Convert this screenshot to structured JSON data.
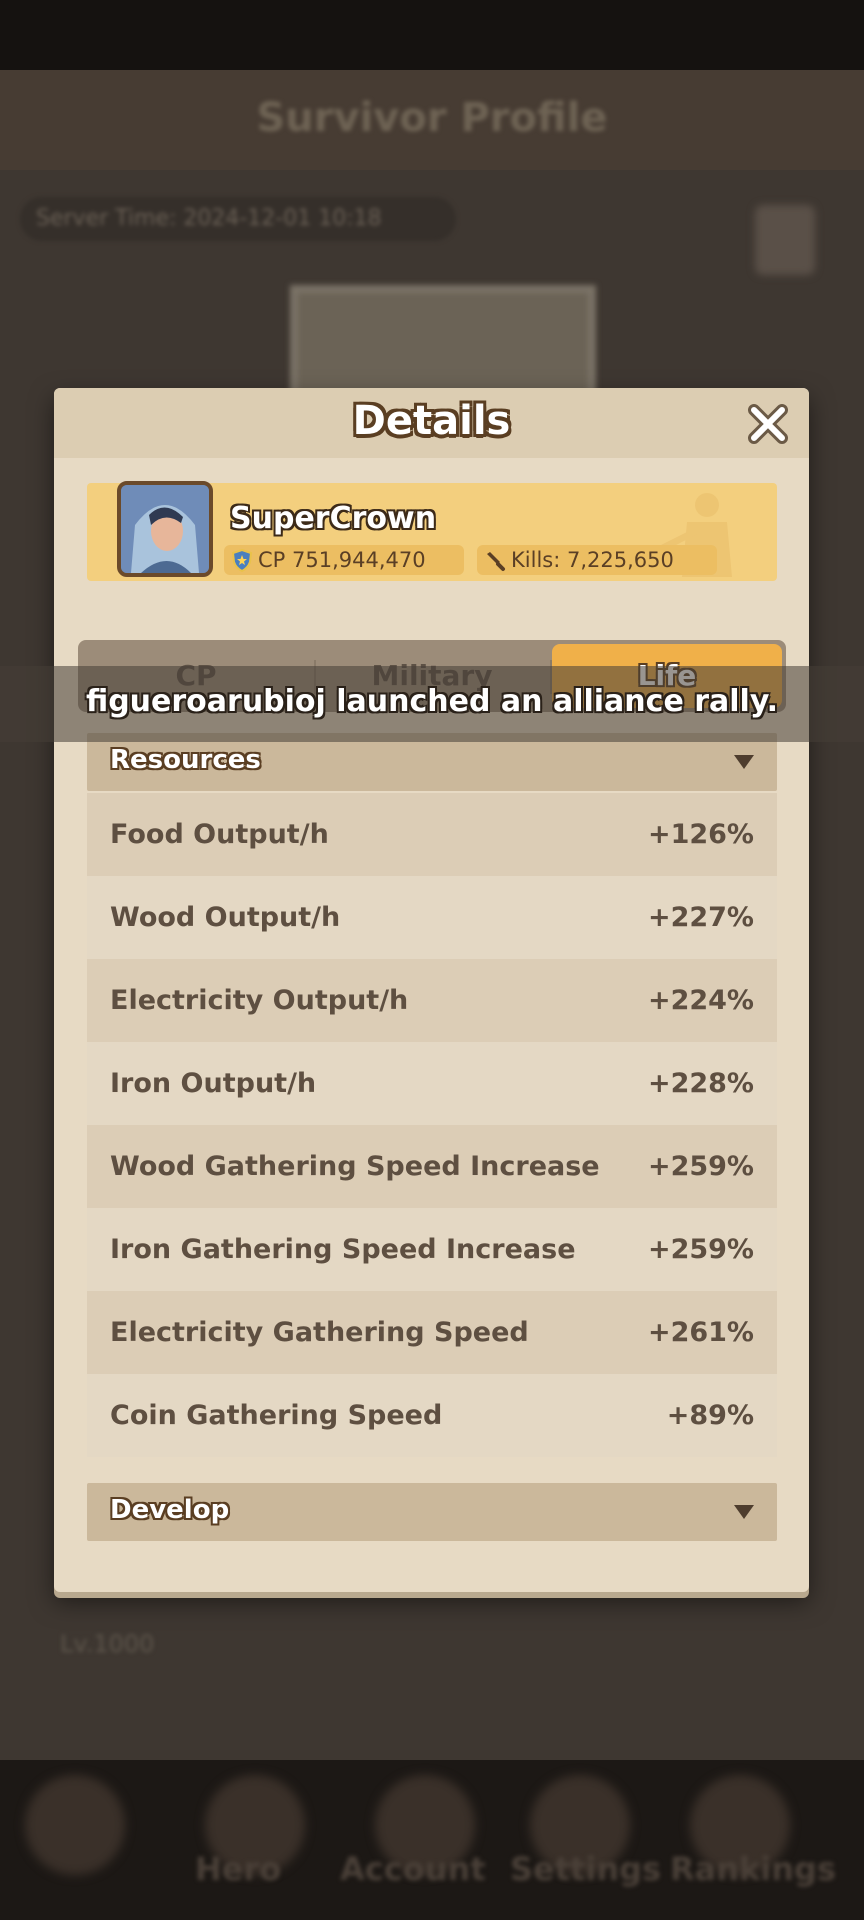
{
  "background": {
    "page_title": "Survivor Profile",
    "server_time": "Server Time: 2024-12-01 10:18",
    "chat_preview": "Lv.1000",
    "nav": {
      "items": [
        {
          "label": "Hero"
        },
        {
          "label": "Account"
        },
        {
          "label": "Settings"
        },
        {
          "label": "Rankings"
        }
      ]
    }
  },
  "modal": {
    "title": "Details",
    "close_icon": "close-icon"
  },
  "profile": {
    "name": "SuperCrown",
    "cp": "CP 751,944,470",
    "kills_label": "Kills:",
    "kills_value": "7,225,650"
  },
  "tabs": [
    {
      "label": "CP"
    },
    {
      "label": "Military"
    },
    {
      "label": "Life",
      "selected": true
    }
  ],
  "toast": {
    "message": "figueroarubioj launched an alliance rally."
  },
  "sections": {
    "resources": {
      "title": "Resources",
      "rows": [
        {
          "label": "Food Output/h",
          "value": "+126%"
        },
        {
          "label": "Wood Output/h",
          "value": "+227%"
        },
        {
          "label": "Electricity Output/h",
          "value": "+224%"
        },
        {
          "label": "Iron Output/h",
          "value": "+228%"
        },
        {
          "label": "Wood Gathering Speed Increase",
          "value": "+259%"
        },
        {
          "label": "Iron Gathering Speed Increase",
          "value": "+259%"
        },
        {
          "label": "Electricity Gathering Speed",
          "value": "+261%"
        },
        {
          "label": "Coin Gathering Speed",
          "value": "+89%"
        }
      ]
    },
    "develop": {
      "title": "Develop"
    }
  },
  "colors": {
    "accent_tab": "#f0b049",
    "banner": "#f3cf7e",
    "panel": "#e7dac4",
    "text_dark": "#5e4f41"
  }
}
